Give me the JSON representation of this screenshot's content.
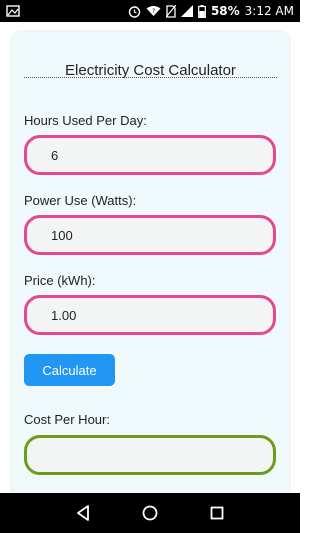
{
  "status_bar": {
    "icons": [
      "image-icon",
      "alarm-icon",
      "wifi-icon",
      "no-sim-icon",
      "signal-icon",
      "battery-icon"
    ],
    "battery_percent": "58%",
    "time": "3:12 AM"
  },
  "calculator": {
    "title": "Electricity Cost Calculator",
    "fields": [
      {
        "label": "Hours Used Per Day:",
        "value": "6"
      },
      {
        "label": "Power Use (Watts):",
        "value": "100"
      },
      {
        "label": "Price (kWh):",
        "value": "1.00"
      }
    ],
    "button_label": "Calculate",
    "result_label": "Cost Per Hour:",
    "result_value": ""
  },
  "colors": {
    "input_border": "#e8478d",
    "result_border": "#6f9a1a",
    "button": "#2196f3",
    "card_bg": "#f0f9fb"
  },
  "nav_bar": {
    "icons": [
      "back-icon",
      "home-icon",
      "recents-icon"
    ]
  }
}
